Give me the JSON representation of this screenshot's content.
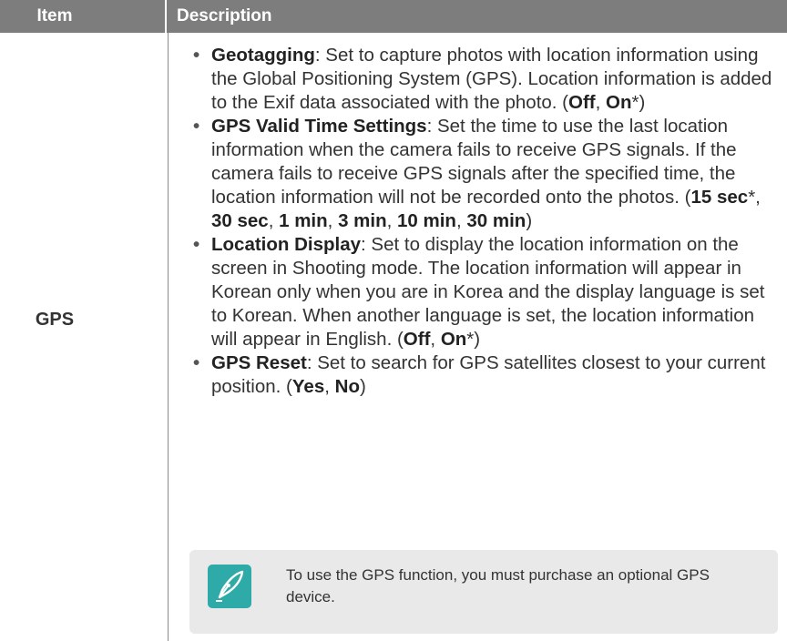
{
  "header": {
    "item": "Item",
    "description": "Description"
  },
  "row": {
    "item": "GPS",
    "bullets": [
      {
        "term": "Geotagging",
        "text": ": Set to capture photos with location information using the Global Positioning System (GPS). Location information is added to the Exif data associated with the photo. (",
        "options": [
          "Off",
          "On"
        ],
        "default_marker": "*",
        "tail": ")"
      },
      {
        "term": "GPS Valid Time Settings",
        "text": ": Set the time to use the last location information when the camera fails to receive GPS signals. If the camera fails to receive GPS signals after the specified time, the location information will not be recorded onto the photos. (",
        "options": [
          "15 sec",
          "30 sec",
          "1 min",
          "3 min",
          "10 min",
          "30 min"
        ],
        "tail": ")"
      },
      {
        "term": "Location Display",
        "text": ": Set to display the location information on the screen in Shooting mode. The location information will appear in Korean only when you are in Korea and the display language is set to Korean. When another language is set, the location information will appear in English. (",
        "options": [
          "Off",
          "On"
        ],
        "tail": ")"
      },
      {
        "term": "GPS Reset",
        "text": ": Set to search for GPS satellites closest to your current position. (",
        "options": [
          "Yes",
          "No"
        ],
        "tail": ")"
      }
    ],
    "note": {
      "icon": "pen-nib-icon",
      "text": "To use the GPS function, you must purchase an optional GPS device."
    }
  },
  "colors": {
    "header_bg": "#7d7d7d",
    "note_bg": "#e9e9e9",
    "icon_bg": "#2eaba8"
  }
}
